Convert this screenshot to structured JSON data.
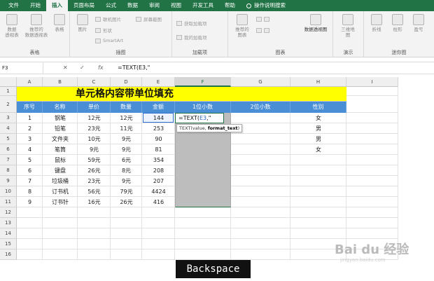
{
  "tabs": [
    "文件",
    "开始",
    "插入",
    "页面布局",
    "公式",
    "数据",
    "审阅",
    "视图",
    "开发工具",
    "帮助"
  ],
  "active_tab": "插入",
  "tell_me": "操作说明搜索",
  "ribbon": {
    "groups": {
      "tables": "表格",
      "illustrations": "插图",
      "addins": "加载项",
      "charts": "图表",
      "tours": "演示",
      "sparklines": "迷你图"
    },
    "buttons": {
      "pivot": "数据\n透视表",
      "recommended_pivot": "推荐的\n数据透视表",
      "table": "表格",
      "pictures": "图片",
      "online_pictures": "联机图片",
      "shapes": "形状",
      "screenshot": "屏幕截图",
      "smartart": "SmartArt",
      "get_addins": "获取加载项",
      "my_addins": "我的加载项",
      "recommended_charts": "推荐的\n图表",
      "pivot_chart": "数据透视图",
      "map3d": "三维地\n图",
      "line": "折线",
      "column": "柱形",
      "winloss": "盈亏"
    }
  },
  "formula_bar": {
    "name_box": "F3",
    "cancel": "✕",
    "enter": "✓",
    "fx": "fx",
    "formula": "=TEXT(E3,\""
  },
  "columns": [
    "A",
    "B",
    "C",
    "D",
    "E",
    "F",
    "G",
    "H",
    "I"
  ],
  "rows": [
    "1",
    "2",
    "3",
    "4",
    "5",
    "6",
    "7",
    "8",
    "9",
    "10",
    "11",
    "12",
    "13",
    "14",
    "15",
    "16"
  ],
  "sheet": {
    "title": "单元格内容带单位填充",
    "headers": [
      "序号",
      "名称",
      "单价",
      "数量",
      "金额",
      "1位小数",
      "2位小数",
      "性别"
    ],
    "data": [
      {
        "no": "1",
        "name": "钢笔",
        "price": "12元",
        "qty": "12元",
        "amount": "144",
        "sex": "女"
      },
      {
        "no": "2",
        "name": "铅笔",
        "price": "23元",
        "qty": "11元",
        "amount": "253",
        "sex": "男"
      },
      {
        "no": "3",
        "name": "文件夹",
        "price": "10元",
        "qty": "9元",
        "amount": "90",
        "sex": "男"
      },
      {
        "no": "4",
        "name": "笔筒",
        "price": "9元",
        "qty": "9元",
        "amount": "81",
        "sex": "女"
      },
      {
        "no": "5",
        "name": "鼠标",
        "price": "59元",
        "qty": "6元",
        "amount": "354",
        "sex": ""
      },
      {
        "no": "6",
        "name": "键盘",
        "price": "26元",
        "qty": "8元",
        "amount": "208",
        "sex": ""
      },
      {
        "no": "7",
        "name": "垃圾桶",
        "price": "23元",
        "qty": "9元",
        "amount": "207",
        "sex": ""
      },
      {
        "no": "8",
        "name": "订书机",
        "price": "56元",
        "qty": "79元",
        "amount": "4424",
        "sex": ""
      },
      {
        "no": "9",
        "name": "订书针",
        "price": "16元",
        "qty": "26元",
        "amount": "416",
        "sex": ""
      }
    ],
    "editing": {
      "prefix": "=TEXT(",
      "ref": "E3",
      "suffix": ",\""
    },
    "tooltip": {
      "fn": "TEXT(value, ",
      "arg": "format_text",
      "end": ")"
    }
  },
  "keystroke": "Backspace",
  "watermark": {
    "logo": "Bai du 经验",
    "url": "jingyan.baidu.com"
  }
}
